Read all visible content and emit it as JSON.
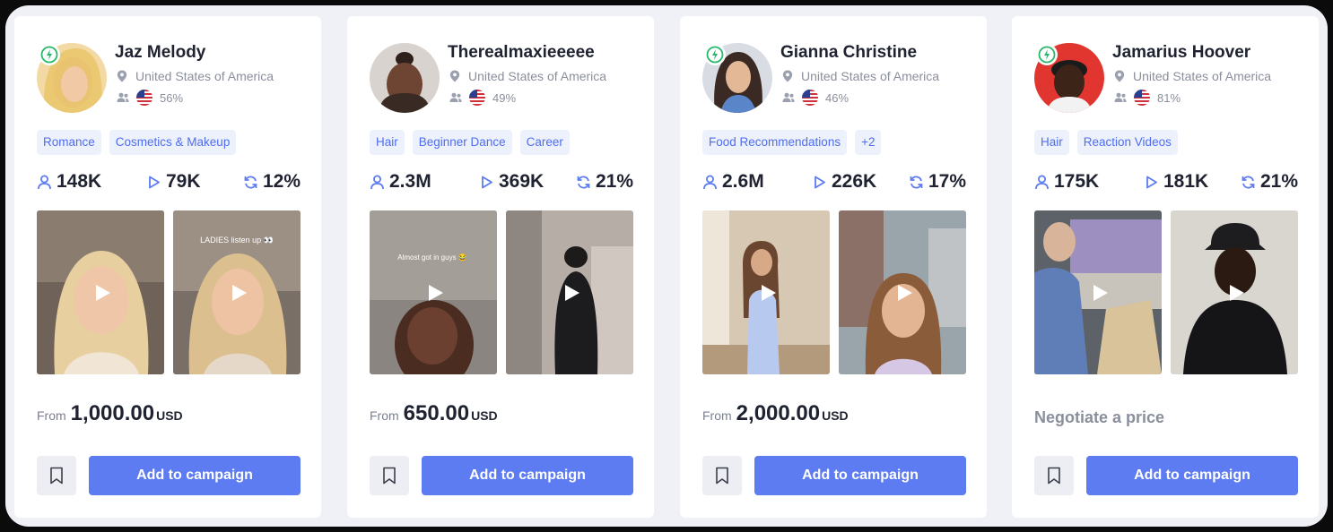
{
  "colors": {
    "accent": "#5d7cf2",
    "tag_text": "#4e6df0",
    "tag_bg": "#edf1fb",
    "verified_green": "#26b86a"
  },
  "cards": [
    {
      "name": "Jaz Melody",
      "verified": true,
      "location": "United States of America",
      "audience_pct": "56%",
      "tags": [
        "Romance",
        "Cosmetics & Makeup"
      ],
      "followers": "148K",
      "avg_views": "79K",
      "engagement": "12%",
      "video_captions": [
        "",
        "LADIES listen up 👀"
      ],
      "price_from": "From",
      "price": "1,000.00",
      "currency": "USD",
      "bookmark_icon": "bookmark-icon",
      "cta": "Add to campaign"
    },
    {
      "name": "Therealmaxieeeee",
      "verified": false,
      "location": "United States of America",
      "audience_pct": "49%",
      "tags": [
        "Hair",
        "Beginner Dance",
        "Career"
      ],
      "followers": "2.3M",
      "avg_views": "369K",
      "engagement": "21%",
      "video_captions": [
        "Almost got in guys 😂",
        ""
      ],
      "price_from": "From",
      "price": "650.00",
      "currency": "USD",
      "bookmark_icon": "bookmark-icon",
      "cta": "Add to campaign"
    },
    {
      "name": "Gianna Christine",
      "verified": true,
      "location": "United States of America",
      "audience_pct": "46%",
      "tags": [
        "Food Recommendations",
        "+2"
      ],
      "followers": "2.6M",
      "avg_views": "226K",
      "engagement": "17%",
      "video_captions": [
        "",
        ""
      ],
      "price_from": "From",
      "price": "2,000.00",
      "currency": "USD",
      "bookmark_icon": "bookmark-icon",
      "cta": "Add to campaign"
    },
    {
      "name": "Jamarius Hoover",
      "verified": true,
      "location": "United States of America",
      "audience_pct": "81%",
      "tags": [
        "Hair",
        "Reaction Videos"
      ],
      "followers": "175K",
      "avg_views": "181K",
      "engagement": "21%",
      "video_captions": [
        "",
        ""
      ],
      "negotiate": "Negotiate a price",
      "bookmark_icon": "bookmark-icon",
      "cta": "Add to campaign"
    }
  ]
}
